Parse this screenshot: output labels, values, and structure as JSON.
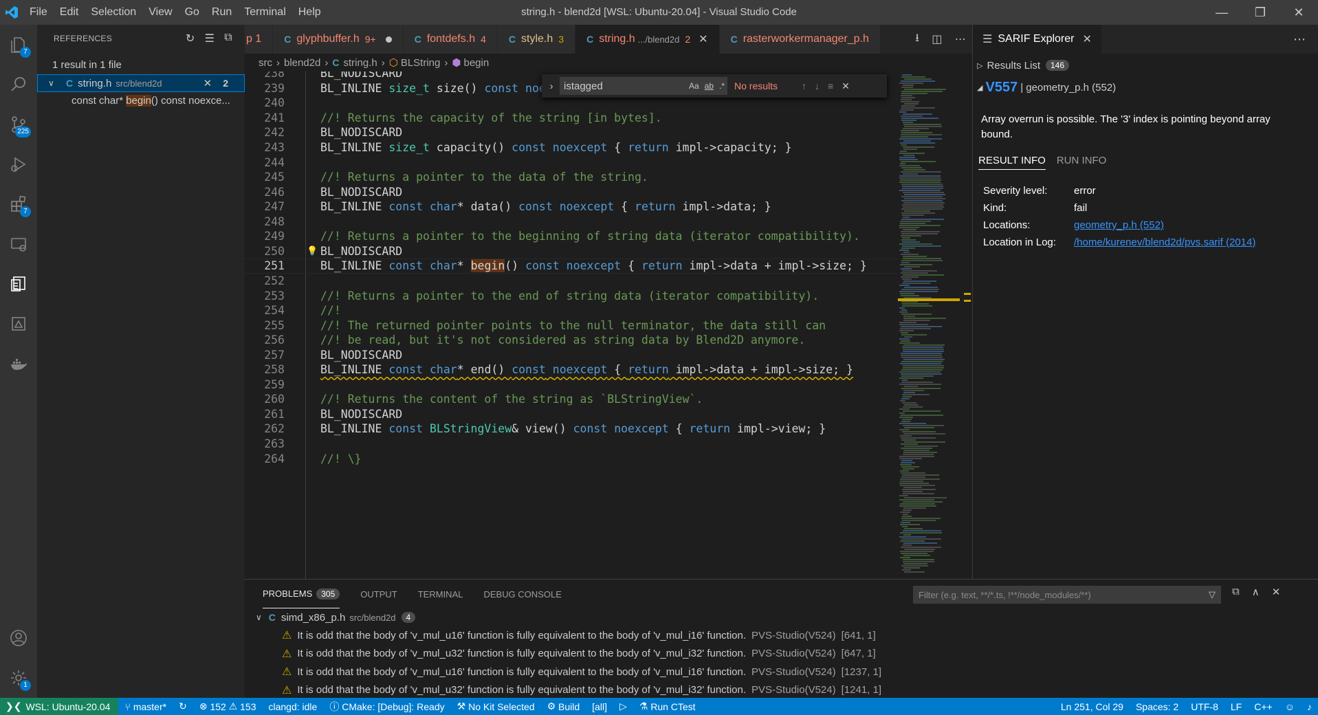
{
  "titlebar": {
    "title": "string.h - blend2d [WSL: Ubuntu-20.04] - Visual Studio Code",
    "menu": [
      "File",
      "Edit",
      "Selection",
      "View",
      "Go",
      "Run",
      "Terminal",
      "Help"
    ]
  },
  "activity": {
    "explorer_badge": "7",
    "scm_badge": "225",
    "extensions_badge": "7",
    "settings_badge": "1"
  },
  "sidebar": {
    "title": "REFERENCES",
    "summary": "1 result in 1 file",
    "file": {
      "name": "string.h",
      "path": "src/blend2d",
      "count": "2"
    },
    "ref_prefix": "const char* ",
    "ref_match": "begin",
    "ref_suffix": "() const noexce..."
  },
  "tabs": [
    {
      "name": "p 1",
      "desc": "",
      "count": "",
      "style": "err"
    },
    {
      "name": "glyphbuffer.h",
      "desc": "",
      "count": "9+",
      "style": "err",
      "dirty": true
    },
    {
      "name": "fontdefs.h",
      "desc": "",
      "count": "4",
      "style": "err"
    },
    {
      "name": "style.h",
      "desc": "",
      "count": "3",
      "style": "warn"
    },
    {
      "name": "string.h",
      "desc": ".../blend2d",
      "count": "2",
      "style": "err",
      "active": true
    },
    {
      "name": "rasterworkermanager_p.h",
      "desc": "",
      "count": "",
      "style": "err"
    }
  ],
  "breadcrumb": {
    "p1": "src",
    "p2": "blend2d",
    "p3": "string.h",
    "p4": "BLString",
    "p5": "begin"
  },
  "find": {
    "value": "istagged",
    "results": "No results",
    "opt1": "Aa",
    "opt2": "ab",
    "opt3": ".*"
  },
  "code_lines": [
    {
      "n": "238",
      "parts": [
        [
          "BL_NODISCARD",
          ""
        ]
      ]
    },
    {
      "n": "239",
      "parts": [
        [
          "BL_INLINE ",
          ""
        ],
        [
          "size_t",
          "ty"
        ],
        [
          " size() ",
          ""
        ],
        [
          "const",
          "kw"
        ],
        [
          " ",
          ""
        ],
        [
          "noexcept",
          "kw"
        ],
        [
          " { ",
          ""
        ],
        [
          "return",
          "kw"
        ],
        [
          " impl->size; }",
          ""
        ]
      ]
    },
    {
      "n": "240",
      "parts": []
    },
    {
      "n": "241",
      "parts": [
        [
          "//! Returns the capacity of the string [in bytes].",
          "cm"
        ]
      ]
    },
    {
      "n": "242",
      "parts": [
        [
          "BL_NODISCARD",
          ""
        ]
      ]
    },
    {
      "n": "243",
      "parts": [
        [
          "BL_INLINE ",
          ""
        ],
        [
          "size_t",
          "ty"
        ],
        [
          " capacity() ",
          ""
        ],
        [
          "const",
          "kw"
        ],
        [
          " ",
          ""
        ],
        [
          "noexcept",
          "kw"
        ],
        [
          " { ",
          ""
        ],
        [
          "return",
          "kw"
        ],
        [
          " impl->capacity; }",
          ""
        ]
      ]
    },
    {
      "n": "244",
      "parts": []
    },
    {
      "n": "245",
      "parts": [
        [
          "//! Returns a pointer to the data of the string.",
          "cm"
        ]
      ]
    },
    {
      "n": "246",
      "parts": [
        [
          "BL_NODISCARD",
          ""
        ]
      ]
    },
    {
      "n": "247",
      "parts": [
        [
          "BL_INLINE ",
          ""
        ],
        [
          "const",
          "kw"
        ],
        [
          " ",
          ""
        ],
        [
          "char",
          "kw"
        ],
        [
          "* data() ",
          ""
        ],
        [
          "const",
          "kw"
        ],
        [
          " ",
          ""
        ],
        [
          "noexcept",
          "kw"
        ],
        [
          " { ",
          ""
        ],
        [
          "return",
          "kw"
        ],
        [
          " impl->data; }",
          ""
        ]
      ]
    },
    {
      "n": "248",
      "parts": []
    },
    {
      "n": "249",
      "parts": [
        [
          "//! Returns a pointer to the beginning of string data (iterator compatibility).",
          "cm"
        ]
      ]
    },
    {
      "n": "250",
      "parts": [
        [
          "BL_NODISCARD",
          ""
        ]
      ],
      "bulb": true
    },
    {
      "n": "251",
      "parts": [
        [
          "BL_INLINE ",
          ""
        ],
        [
          "const",
          "kw"
        ],
        [
          " ",
          ""
        ],
        [
          "char",
          "kw"
        ],
        [
          "* ",
          ""
        ],
        [
          "begin",
          "hlb"
        ],
        [
          "() ",
          ""
        ],
        [
          "const",
          "kw"
        ],
        [
          " ",
          ""
        ],
        [
          "noexcept",
          "kw"
        ],
        [
          " { ",
          ""
        ],
        [
          "return",
          "kw"
        ],
        [
          " impl->data + impl->size; }",
          ""
        ]
      ],
      "current": true
    },
    {
      "n": "252",
      "parts": []
    },
    {
      "n": "253",
      "parts": [
        [
          "//! Returns a pointer to the end of string data (iterator compatibility).",
          "cm"
        ]
      ]
    },
    {
      "n": "254",
      "parts": [
        [
          "//!",
          "cm"
        ]
      ]
    },
    {
      "n": "255",
      "parts": [
        [
          "//! The returned pointer points to the null terminator, the data still can",
          "cm"
        ]
      ]
    },
    {
      "n": "256",
      "parts": [
        [
          "//! be read, but it's not considered as string data by Blend2D anymore.",
          "cm"
        ]
      ]
    },
    {
      "n": "257",
      "parts": [
        [
          "BL_NODISCARD",
          ""
        ]
      ]
    },
    {
      "n": "258",
      "parts": [
        [
          "BL_INLINE ",
          ""
        ],
        [
          "const",
          "kw"
        ],
        [
          " ",
          ""
        ],
        [
          "char",
          "kw"
        ],
        [
          "* end() ",
          ""
        ],
        [
          "const",
          "kw"
        ],
        [
          " ",
          ""
        ],
        [
          "noexcept",
          "kw"
        ],
        [
          " { ",
          ""
        ],
        [
          "return",
          "kw"
        ],
        [
          " impl->data + impl->size; }",
          ""
        ]
      ],
      "squiggle": true
    },
    {
      "n": "259",
      "parts": []
    },
    {
      "n": "260",
      "parts": [
        [
          "//! Returns the content of the string as `BLStringView`.",
          "cm"
        ]
      ]
    },
    {
      "n": "261",
      "parts": [
        [
          "BL_NODISCARD",
          ""
        ]
      ]
    },
    {
      "n": "262",
      "parts": [
        [
          "BL_INLINE ",
          ""
        ],
        [
          "const",
          "kw"
        ],
        [
          " ",
          ""
        ],
        [
          "BLStringView",
          "ty"
        ],
        [
          "& view() ",
          ""
        ],
        [
          "const",
          "kw"
        ],
        [
          " ",
          ""
        ],
        [
          "noexcept",
          "kw"
        ],
        [
          " { ",
          ""
        ],
        [
          "return",
          "kw"
        ],
        [
          " impl->view; }",
          ""
        ]
      ]
    },
    {
      "n": "263",
      "parts": []
    },
    {
      "n": "264",
      "parts": [
        [
          "//! \\}",
          "cm"
        ]
      ]
    }
  ],
  "sarif": {
    "tab_title": "SARIF Explorer",
    "results_label": "Results List",
    "results_count": "146",
    "rule_id": "V557",
    "rule_loc": "| geometry_p.h (552)",
    "message": "Array overrun is possible. The '3' index is pointing beyond array bound.",
    "tab_result": "RESULT INFO",
    "tab_run": "RUN INFO",
    "info": [
      {
        "k": "Severity level:",
        "v": "error",
        "link": false
      },
      {
        "k": "Kind:",
        "v": "fail",
        "link": false
      },
      {
        "k": "Locations:",
        "v": "geometry_p.h (552)",
        "link": true
      },
      {
        "k": "Location in Log:",
        "v": "/home/kurenev/blend2d/pvs.sarif (2014)",
        "link": true
      }
    ]
  },
  "panel": {
    "tabs": [
      "PROBLEMS",
      "OUTPUT",
      "TERMINAL",
      "DEBUG CONSOLE"
    ],
    "problems_count": "305",
    "filter_placeholder": "Filter (e.g. text, **/*.ts, !**/node_modules/**)",
    "group": {
      "name": "simd_x86_p.h",
      "path": "src/blend2d",
      "count": "4"
    },
    "items": [
      {
        "msg": "It is odd that the body of 'v_mul_u16' function is fully equivalent to the body of 'v_mul_i16' function.",
        "src": "PVS-Studio(V524)",
        "pos": "[641, 1]"
      },
      {
        "msg": "It is odd that the body of 'v_mul_u32' function is fully equivalent to the body of 'v_mul_i32' function.",
        "src": "PVS-Studio(V524)",
        "pos": "[647, 1]"
      },
      {
        "msg": "It is odd that the body of 'v_mul_u16' function is fully equivalent to the body of 'v_mul_i16' function.",
        "src": "PVS-Studio(V524)",
        "pos": "[1237, 1]"
      },
      {
        "msg": "It is odd that the body of 'v_mul_u32' function is fully equivalent to the body of 'v_mul_i32' function.",
        "src": "PVS-Studio(V524)",
        "pos": "[1241, 1]"
      }
    ]
  },
  "status": {
    "remote": "WSL: Ubuntu-20.04",
    "branch": "master*",
    "errors": "152",
    "warnings": "153",
    "clangd": "clangd: idle",
    "cmake": "CMake: [Debug]: Ready",
    "kit": "No Kit Selected",
    "build": "Build",
    "target": "[all]",
    "ctest": "Run CTest",
    "position": "Ln 251, Col 29",
    "spaces": "Spaces: 2",
    "encoding": "UTF-8",
    "eol": "LF",
    "language": "C++"
  }
}
